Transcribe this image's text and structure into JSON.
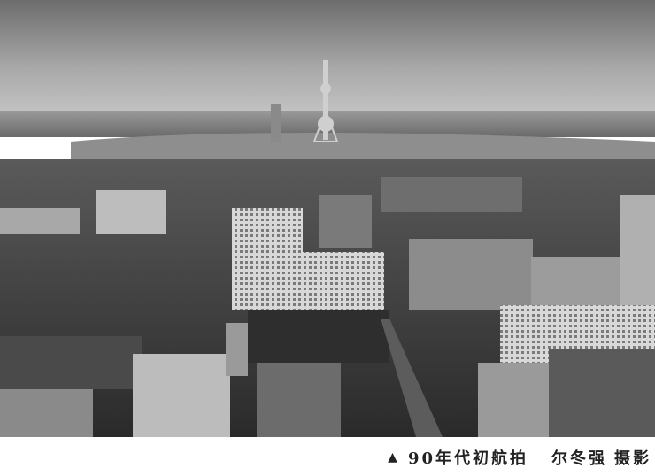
{
  "caption": {
    "marker_icon": "triangle-up-icon",
    "text": "90年代初航拍",
    "author": "尔冬强",
    "credit": "摄影"
  }
}
